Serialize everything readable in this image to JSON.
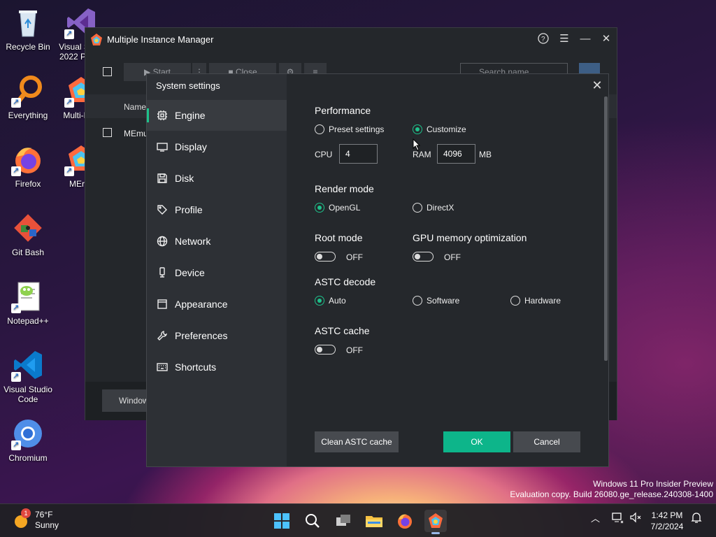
{
  "desktop": {
    "icons": [
      {
        "label": "Recycle Bin",
        "icon": "recycle-bin-icon"
      },
      {
        "label": "Visual S… 2022 Pr…",
        "icon": "visual-studio-2022-icon"
      },
      {
        "label": "Everything",
        "icon": "everything-search-icon"
      },
      {
        "label": "Multi-M…",
        "icon": "memu-multi-instance-icon"
      },
      {
        "label": "Firefox",
        "icon": "firefox-icon"
      },
      {
        "label": "MEr…",
        "icon": "memu-icon"
      },
      {
        "label": "Git Bash",
        "icon": "git-bash-icon"
      },
      {
        "label": "Notepad++",
        "icon": "notepad-plus-plus-icon"
      },
      {
        "label": "Visual Studio Code",
        "icon": "vscode-icon"
      },
      {
        "label": "Chromium",
        "icon": "chromium-icon"
      }
    ]
  },
  "mim_window": {
    "title": "Multiple Instance Manager",
    "toolbar": {
      "start_label": "▶ Start",
      "more_label": "⋮",
      "close_label": "■ Close",
      "settings_label": "⚙",
      "menu_label": "≡",
      "search_placeholder": "Search name"
    },
    "table_header_name": "Name",
    "rows": [
      {
        "name": "MEmu"
      }
    ],
    "bottom_button": "Window"
  },
  "dialog": {
    "title": "System settings",
    "nav": [
      {
        "label": "Engine",
        "icon": "chip-icon",
        "active": true
      },
      {
        "label": "Display",
        "icon": "monitor-icon"
      },
      {
        "label": "Disk",
        "icon": "disk-icon"
      },
      {
        "label": "Profile",
        "icon": "tag-icon"
      },
      {
        "label": "Network",
        "icon": "globe-icon"
      },
      {
        "label": "Device",
        "icon": "device-icon"
      },
      {
        "label": "Appearance",
        "icon": "window-icon"
      },
      {
        "label": "Preferences",
        "icon": "wrench-icon"
      },
      {
        "label": "Shortcuts",
        "icon": "keyboard-icon"
      }
    ],
    "performance": {
      "title": "Performance",
      "preset_label": "Preset settings",
      "customize_label": "Customize",
      "selected": "Customize",
      "cpu_label": "CPU",
      "cpu_value": "4",
      "ram_label": "RAM",
      "ram_value": "4096",
      "ram_unit": "MB"
    },
    "render_mode": {
      "title": "Render mode",
      "opengl_label": "OpenGL",
      "directx_label": "DirectX",
      "selected": "OpenGL"
    },
    "root_mode": {
      "title": "Root mode",
      "state": "OFF"
    },
    "gpu_memory": {
      "title": "GPU memory optimization",
      "state": "OFF"
    },
    "astc_decode": {
      "title": "ASTC decode",
      "auto_label": "Auto",
      "software_label": "Software",
      "hardware_label": "Hardware",
      "selected": "Auto"
    },
    "astc_cache": {
      "title": "ASTC cache",
      "state": "OFF"
    },
    "buttons": {
      "clean_label": "Clean ASTC cache",
      "ok_label": "OK",
      "cancel_label": "Cancel"
    },
    "colors": {
      "accent": "#1ec28b",
      "ok_button": "#0db58a"
    }
  },
  "watermark": {
    "line1": "Windows 11 Pro Insider Preview",
    "line2": "Evaluation copy. Build 26080.ge_release.240308-1400"
  },
  "taskbar": {
    "weather_temp": "76°F",
    "weather_cond": "Sunny",
    "weather_badge": "1",
    "time": "1:42 PM",
    "date": "7/2/2024"
  }
}
